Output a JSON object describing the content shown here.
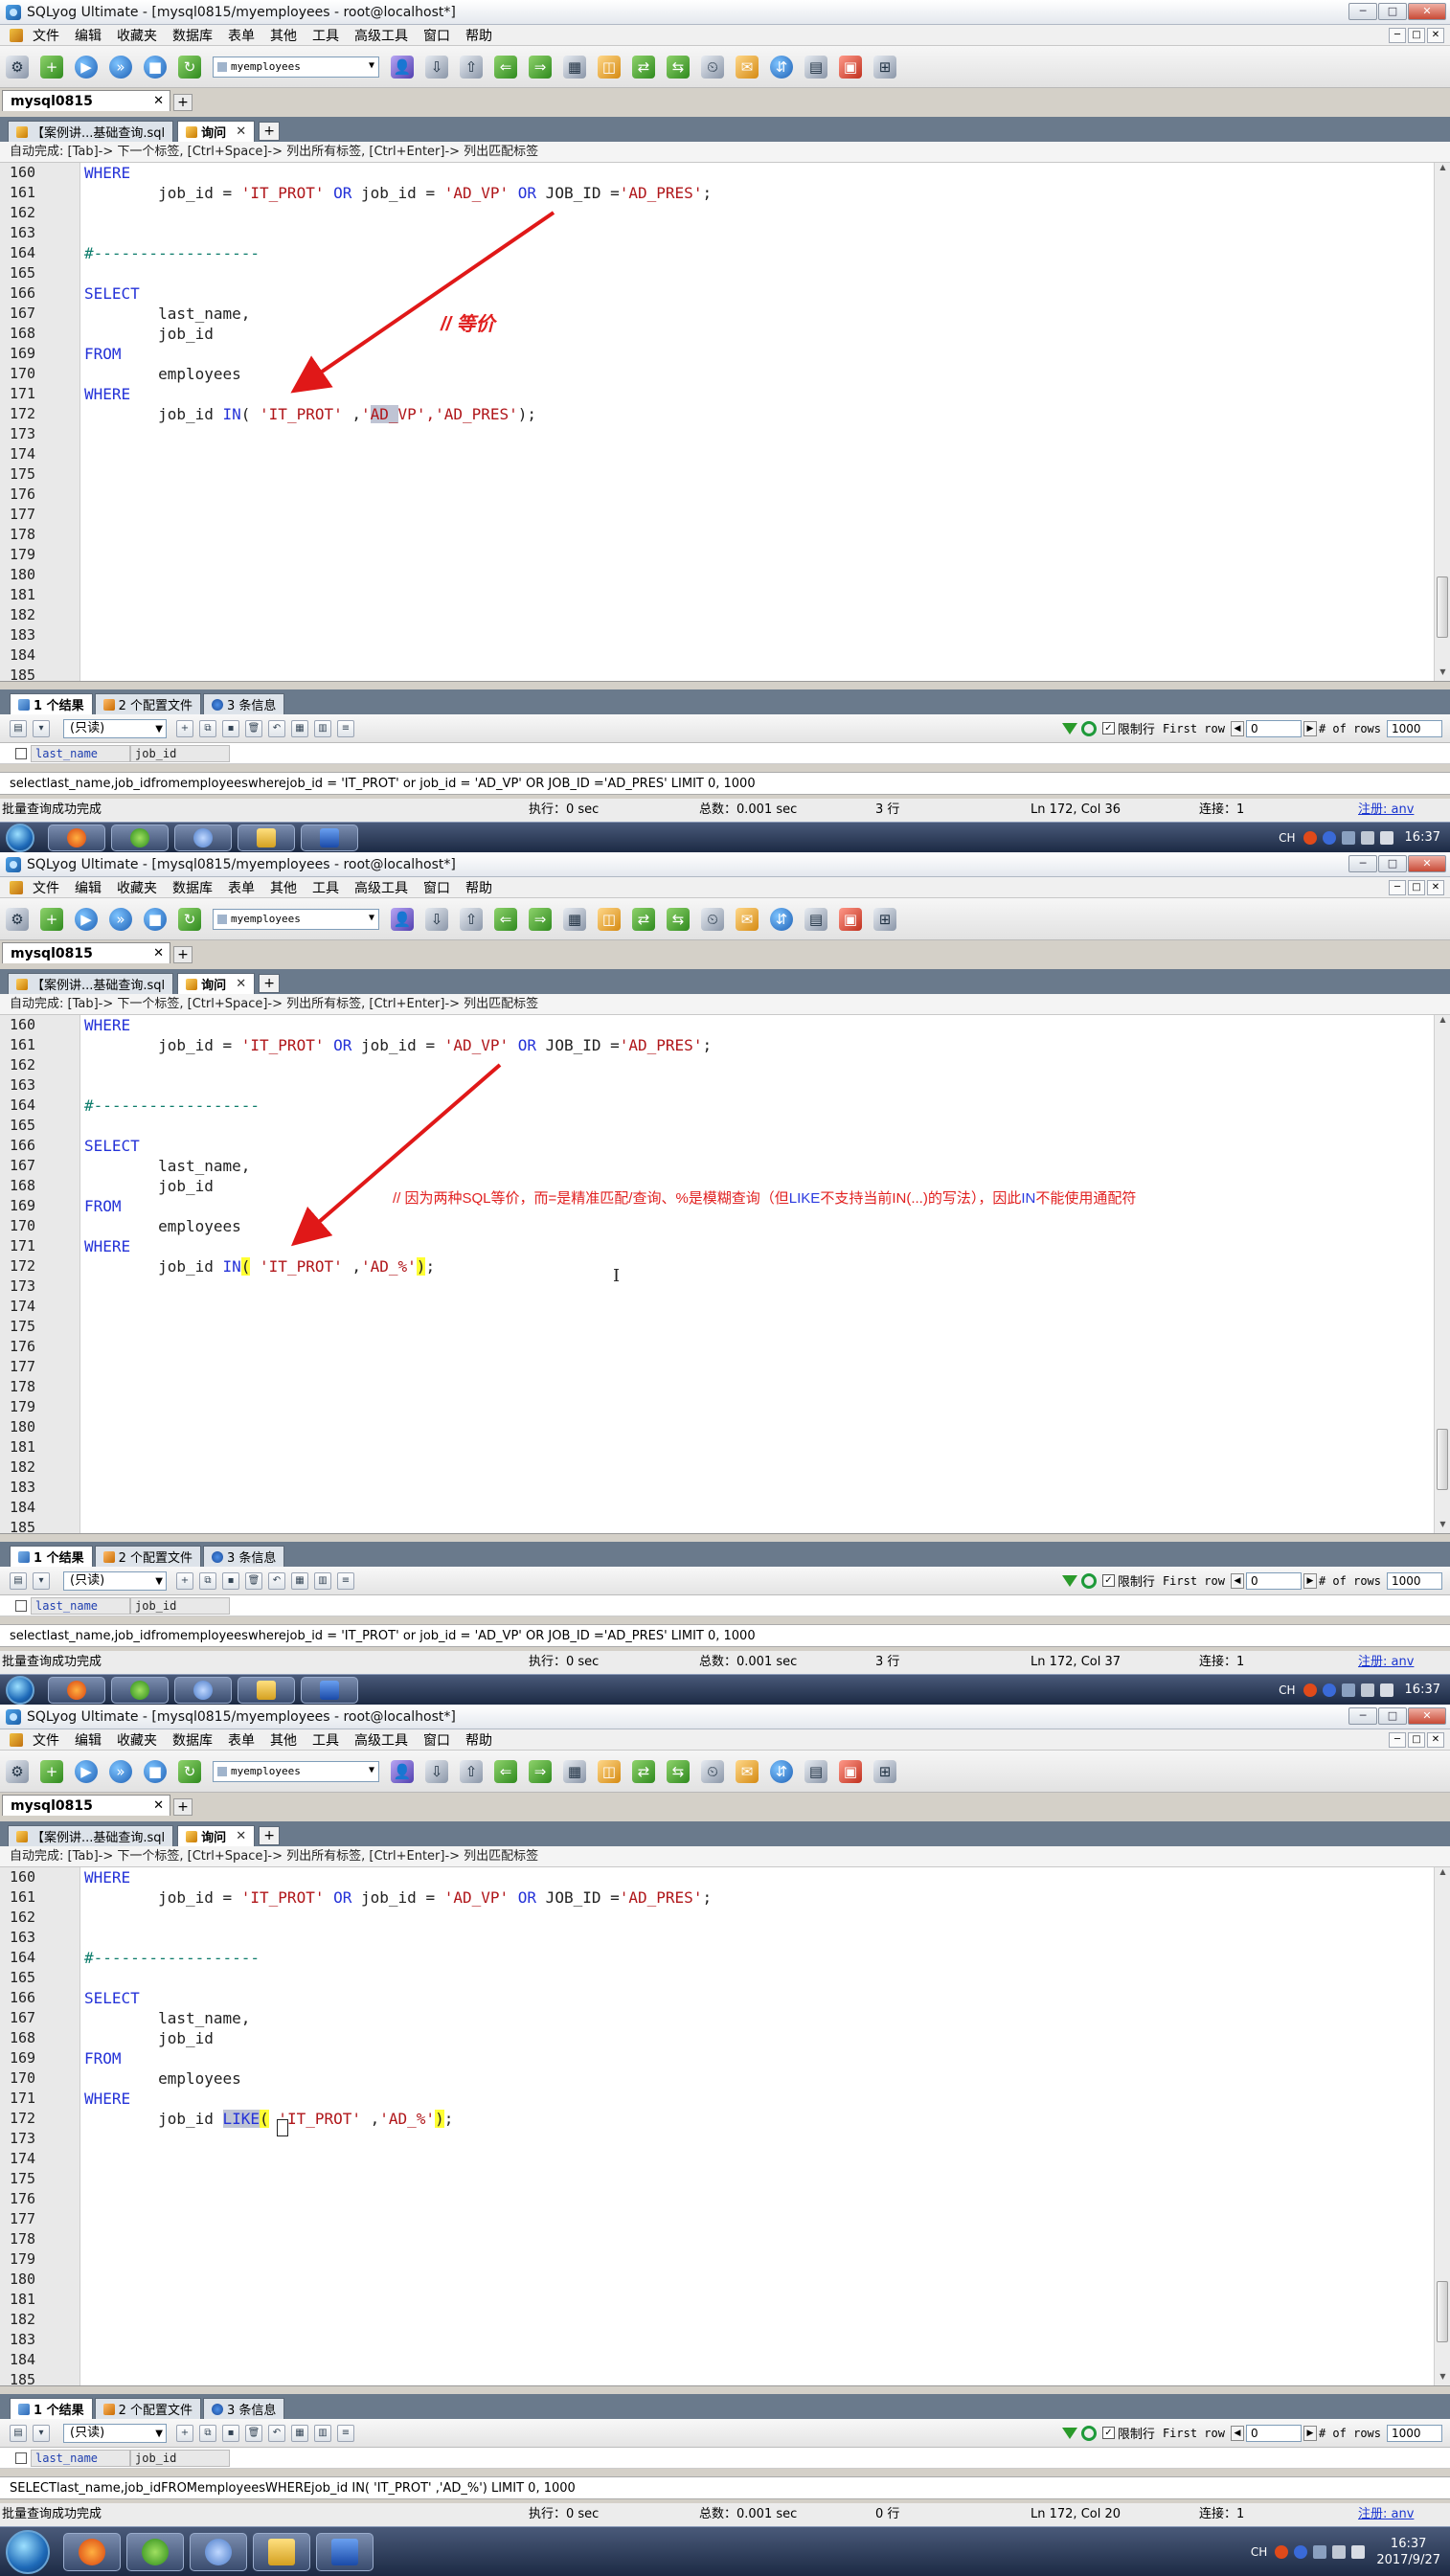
{
  "window": {
    "title": "SQLyog Ultimate - [mysql0815/myemployees - root@localhost*]",
    "buttons": [
      "─",
      "□",
      "✕"
    ]
  },
  "menu": [
    "文件",
    "编辑",
    "收藏夹",
    "数据库",
    "表单",
    "其他",
    "工具",
    "高级工具",
    "窗口",
    "帮助"
  ],
  "toolbar": {
    "db_selector": "myemployees"
  },
  "connection_tab": {
    "label": "mysql0815",
    "close": "✕",
    "add": "+"
  },
  "query_tabs": {
    "file_tab": "【案例讲...基础查询.sql",
    "query_tab": "询问",
    "close": "✕",
    "add": "+"
  },
  "autocomplete_hint": "自动完成: [Tab]-> 下一个标签, [Ctrl+Space]-> 列出所有标签, [Ctrl+Enter]-> 列出匹配标签",
  "result_tabs": [
    "1 个结果",
    "2 个配置文件",
    "3 条信息"
  ],
  "result_toolbar": {
    "readonly": "(只读)",
    "limit_label": "限制行",
    "first_row_label": "First row",
    "first_row_value": "0",
    "rows_label": "# of rows",
    "rows_value": "1000"
  },
  "columns": [
    "last_name",
    "job_id"
  ],
  "panels": [
    {
      "sql_line": "selectlast_name,job_idfromemployeeswherejob_id = 'IT_PROT' or job_id = 'AD_VP' OR JOB_ID ='AD_PRES' LIMIT 0, 1000",
      "status": {
        "msg": "批量查询成功完成",
        "exec": "执行：0 sec",
        "total": "总数：0.001 sec",
        "rows": "3 行",
        "pos": "Ln 172, Col 36",
        "conn": "连接：1",
        "reg": "注册: anv"
      },
      "annotation": "// 等价",
      "line172": {
        "before": "job_id ",
        "kw": "IN",
        "paren_open": "(",
        "s1": " 'IT_PROT'",
        "sep": " ,",
        "s2q": "'",
        "s2mark": "AD_",
        "s2rest": "VP'",
        "s3": ",'AD_PRES'",
        "paren_close": ")",
        "end": ";"
      }
    },
    {
      "sql_line": "selectlast_name,job_idfromemployeeswherejob_id = 'IT_PROT' or job_id = 'AD_VP' OR JOB_ID ='AD_PRES' LIMIT 0, 1000",
      "status": {
        "msg": "批量查询成功完成",
        "exec": "执行：0 sec",
        "total": "总数：0.001 sec",
        "rows": "3 行",
        "pos": "Ln 172, Col 37",
        "conn": "连接：1",
        "reg": "注册: anv"
      },
      "annotation": {
        "p1": "// 因为两种SQL等价，而=是精准匹配/查询、%是模糊查询（但",
        "like": "LIKE",
        "p2": "不支持当前",
        "in1": "IN(...)",
        "p3": "的写法），因此",
        "in2": "IN",
        "p4": "不能使用通配符"
      },
      "line172": {
        "before": "job_id ",
        "kw": "IN",
        "paren_open": "(",
        "s1": " 'IT_PROT'",
        "sep": " ,",
        "s2": "'AD_%'",
        "paren_close": ")",
        "end": ";"
      },
      "caret": "I"
    },
    {
      "sql_line": "SELECTlast_name,job_idFROMemployeesWHEREjob_id IN( 'IT_PROT' ,'AD_%') LIMIT 0, 1000",
      "status": {
        "msg": "批量查询成功完成",
        "exec": "执行：0 sec",
        "total": "总数：0.001 sec",
        "rows": "0 行",
        "pos": "Ln 172, Col 20",
        "conn": "连接：1",
        "reg": "注册: anv"
      },
      "line172": {
        "before": "job_id ",
        "kw": "LIKE",
        "paren_open": "(",
        "s1": " 'IT_PROT'",
        "sep": " ,",
        "s2": "'AD_%'",
        "paren_close": ")",
        "end": ";"
      },
      "clock": {
        "time": "16:37",
        "date": "2017/9/27"
      }
    }
  ],
  "code": {
    "l160": "WHERE",
    "l161_a": "job_id = ",
    "l161_s1": "'IT_PROT'",
    "l161_or1": "OR",
    "l161_b": " job_id = ",
    "l161_s2": "'AD_VP'",
    "l161_or2": "OR",
    "l161_c": " JOB_ID =",
    "l161_s3": "'AD_PRES'",
    "l161_end": ";",
    "l164": "#------------------",
    "l166": "SELECT",
    "l167": "last_name,",
    "l168": "job_id",
    "l169": "FROM",
    "l170": "employees",
    "l171": "WHERE"
  },
  "line_numbers": [
    "160",
    "161",
    "162",
    "163",
    "164",
    "165",
    "166",
    "167",
    "168",
    "169",
    "170",
    "171",
    "172",
    "173",
    "174",
    "175",
    "176",
    "177",
    "178",
    "179",
    "180",
    "181",
    "182",
    "183",
    "184",
    "185"
  ],
  "tray": {
    "lang": "CH",
    "time": "16:37",
    "date": "2017/9/27"
  },
  "colors": {
    "keyword": "#2432d8",
    "string": "#b0161a",
    "comment": "#0e7d6c",
    "annotation": "#e12020",
    "highlight": "#ffff33"
  }
}
